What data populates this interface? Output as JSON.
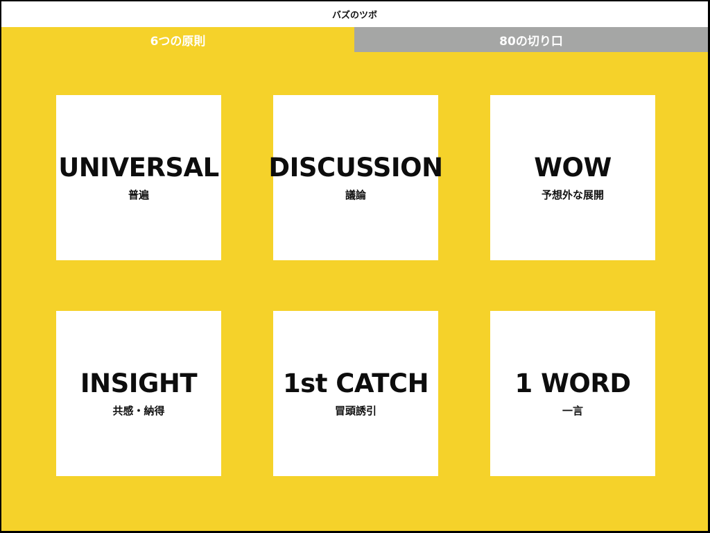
{
  "header": {
    "title": "バズのツボ"
  },
  "tabs": [
    {
      "label": "6つの原則",
      "active": true
    },
    {
      "label": "80の切り口",
      "active": false
    }
  ],
  "cards": [
    {
      "title": "UNIVERSAL",
      "subtitle": "普遍"
    },
    {
      "title": "DISCUSSION",
      "subtitle": "議論"
    },
    {
      "title": "WOW",
      "subtitle": "予想外な展開"
    },
    {
      "title": "INSIGHT",
      "subtitle": "共感・納得"
    },
    {
      "title": "1st CATCH",
      "subtitle": "冒頭誘引"
    },
    {
      "title": "1 WORD",
      "subtitle": "一言"
    }
  ],
  "colors": {
    "background": "#f5d22a",
    "inactive_tab": "#a5a6a5",
    "card": "#ffffff",
    "text": "#0d0d0d"
  }
}
